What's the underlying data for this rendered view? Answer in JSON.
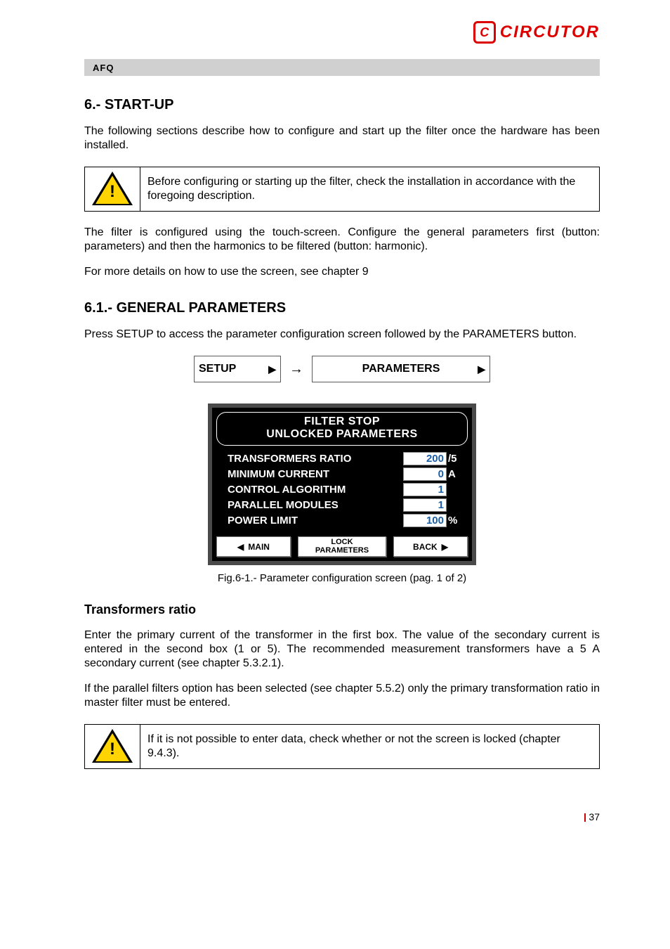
{
  "logo": {
    "icon_letter": "C",
    "text": "CIRCUTOR"
  },
  "title_bar": "AFQ",
  "section_heading": "6.- START-UP",
  "para1": "The following sections describe how to configure and start up the filter once the hardware has been installed.",
  "warn1": "Before configuring or starting up the filter, check the installation in accordance with the foregoing description.",
  "para2": "The filter is configured using the touch-screen. Configure the general parameters first (button: parameters) and then the harmonics to be filtered (button: harmonic).",
  "para3": "For more details on how to use the screen, see chapter 9",
  "h61": "6.1.- GENERAL PARAMETERS",
  "para4": "Press SETUP to access the parameter configuration screen followed by the PARAMETERS button.",
  "nav": {
    "setup": "SETUP",
    "parameters": "PARAMETERS"
  },
  "panel": {
    "head_line1": "FILTER STOP",
    "head_line2": "UNLOCKED PARAMETERS",
    "rows": [
      {
        "label": "TRANSFORMERS RATIO",
        "value": "200",
        "unit": "/5"
      },
      {
        "label": "MINIMUM CURRENT",
        "value": "0",
        "unit": "A"
      },
      {
        "label": "CONTROL ALGORITHM",
        "value": "1",
        "unit": ""
      },
      {
        "label": "PARALLEL MODULES",
        "value": "1",
        "unit": ""
      },
      {
        "label": "POWER LIMIT",
        "value": "100",
        "unit": "%"
      }
    ],
    "footer": {
      "main": "MAIN",
      "lock1": "LOCK",
      "lock2": "PARAMETERS",
      "back": "BACK"
    }
  },
  "fig_caption": "Fig.6-1.- Parameter configuration screen (pag. 1 of 2)",
  "subsection": "Transformers ratio",
  "para5": "Enter the primary current of the transformer in the first box. The value of the secondary current is entered in the second box (1 or 5). The recommended measurement transformers have a 5 A secondary current (see chapter 5.3.2.1).",
  "para6": "If the parallel filters option has been selected (see chapter 5.5.2) only the primary transformation ratio in master filter must be entered.",
  "warn2": "If it is not possible to enter data, check whether or not the screen is locked (chapter 9.4.3).",
  "page_number": "37"
}
